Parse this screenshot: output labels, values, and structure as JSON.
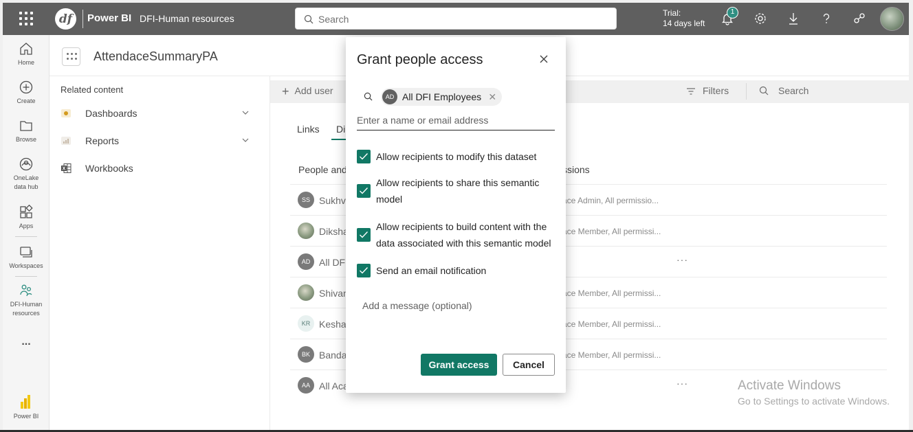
{
  "topbar": {
    "logo_text": "df",
    "brand": "Power BI",
    "workspace": "DFI-Human resources",
    "search_placeholder": "Search",
    "trial_line1": "Trial:",
    "trial_line2": "14 days left",
    "notification_count": "1"
  },
  "leftnav": {
    "items": [
      {
        "label": "Home"
      },
      {
        "label": "Create"
      },
      {
        "label": "Browse"
      },
      {
        "label": "OneLake data hub"
      },
      {
        "label": "Apps"
      },
      {
        "label": "Workspaces"
      },
      {
        "label": "DFI-Human resources"
      },
      {
        "label": "..."
      },
      {
        "label": "Power BI"
      }
    ]
  },
  "page": {
    "title": "AttendaceSummaryPA",
    "related_heading": "Related content",
    "related": [
      {
        "label": "Dashboards"
      },
      {
        "label": "Reports"
      },
      {
        "label": "Workbooks"
      }
    ],
    "add_user": "Add user",
    "filters": "Filters",
    "search": "Search",
    "tabs": [
      {
        "label": "Links"
      },
      {
        "label": "Di"
      }
    ],
    "col_people": "People and",
    "col_perm": "ssions",
    "rows": [
      {
        "initials": "SS",
        "name": "Sukhvi",
        "perm": "ace Admin, All permissio..."
      },
      {
        "initials": "",
        "name": "Diksha",
        "perm": "ace Member, All permissi..."
      },
      {
        "initials": "AD",
        "name": "All DF",
        "perm": ""
      },
      {
        "initials": "",
        "name": "Shivan",
        "perm": "ace Member, All permissi..."
      },
      {
        "initials": "KR",
        "name": "Kesha",
        "perm": "ace Member, All permissi..."
      },
      {
        "initials": "BK",
        "name": "Banda",
        "perm": "ace Member, All permissi..."
      },
      {
        "initials": "AA",
        "name": "All Aca",
        "perm": ""
      }
    ],
    "more": "···"
  },
  "dialog": {
    "title": "Grant people access",
    "chip_initials": "AD",
    "chip_label": "All DFI Employees",
    "input_placeholder": "Enter a name or email address",
    "checkboxes": [
      {
        "label": "Allow recipients to modify this dataset",
        "checked": true
      },
      {
        "label": "Allow recipients to share this semantic model",
        "checked": true
      },
      {
        "label": "Allow recipients to build content with the data associated with this semantic model",
        "checked": true
      },
      {
        "label": "Send an email notification",
        "checked": true
      }
    ],
    "message_placeholder": "Add a message (optional)",
    "grant_label": "Grant access",
    "cancel_label": "Cancel"
  },
  "watermark": {
    "line1": "Activate Windows",
    "line2": "Go to Settings to activate Windows."
  },
  "colors": {
    "accent": "#117865",
    "topbar": "#5f5f5f"
  }
}
